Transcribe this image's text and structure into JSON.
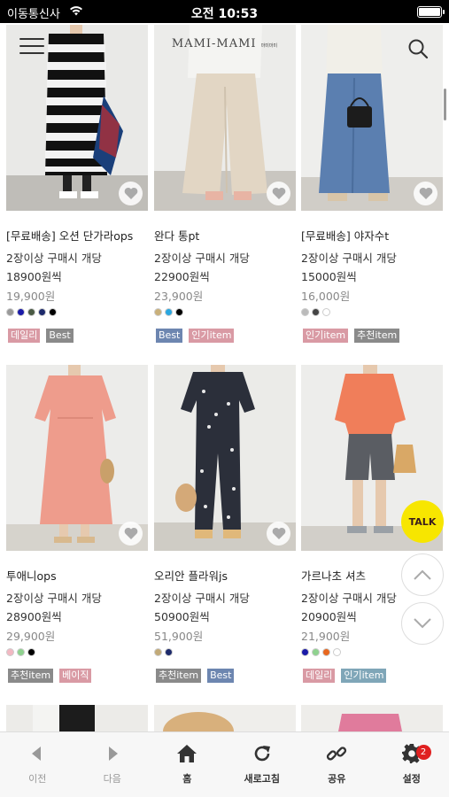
{
  "status_bar": {
    "carrier": "이동통신사",
    "time": "오전 10:53"
  },
  "header": {
    "logo": "MAMI-MAMI",
    "logo_sub": "마미마미"
  },
  "products": [
    {
      "name": "[무료배송] 오션 단가라ops",
      "promo1": "2장이상 구매시 개당",
      "promo2": "18900원씩",
      "price": "19,900원",
      "swatches": [
        "#999999",
        "#1a1aa8",
        "#4a5a44",
        "#1d2a6b",
        "#000000"
      ],
      "badges": [
        {
          "label": "데일리",
          "color": "#d99aa4"
        },
        {
          "label": "Best",
          "color": "#8a8a8a"
        }
      ]
    },
    {
      "name": "완다 통pt",
      "promo1": "2장이상 구매시 개당",
      "promo2": "22900원씩",
      "price": "23,900원",
      "swatches": [
        "#c9b07a",
        "#2aa7e0",
        "#000000"
      ],
      "badges": [
        {
          "label": "Best",
          "color": "#6d86b0"
        },
        {
          "label": "인기item",
          "color": "#d99aa4"
        }
      ]
    },
    {
      "name": "[무료배송] 야자수t",
      "promo1": "2장이상 구매시 개당",
      "promo2": "15000원씩",
      "price": "16,000원",
      "swatches": [
        "#bbbbbb",
        "#444444",
        "#ffffff"
      ],
      "badges": [
        {
          "label": "인기item",
          "color": "#d99aa4"
        },
        {
          "label": "추천item",
          "color": "#8a8a8a"
        }
      ]
    },
    {
      "name": "투애니ops",
      "promo1": "2장이상 구매시 개당",
      "promo2": "28900원씩",
      "price": "29,900원",
      "swatches": [
        "#f2b8c2",
        "#8fd28f",
        "#000000"
      ],
      "badges": [
        {
          "label": "추천item",
          "color": "#8a8a8a"
        },
        {
          "label": "베이직",
          "color": "#d99aa4"
        }
      ]
    },
    {
      "name": "오리안 플라워js",
      "promo1": "2장이상 구매시 개당",
      "promo2": "50900원씩",
      "price": "51,900원",
      "swatches": [
        "#c2aa78",
        "#1d2a6b"
      ],
      "badges": [
        {
          "label": "추천item",
          "color": "#8a8a8a"
        },
        {
          "label": "Best",
          "color": "#6d86b0"
        }
      ]
    },
    {
      "name": "가르나초 셔츠",
      "promo1": "2장이상 구매시 개당",
      "promo2": "20900원씩",
      "price": "21,900원",
      "swatches": [
        "#1a1aa8",
        "#8fd28f",
        "#e8671f",
        "#ffffff"
      ],
      "badges": [
        {
          "label": "데일리",
          "color": "#d99aa4"
        },
        {
          "label": "인기item",
          "color": "#7fa6b8"
        }
      ]
    }
  ],
  "floating": {
    "talk": "TALK"
  },
  "bottom_nav": [
    {
      "label": "이전"
    },
    {
      "label": "다음"
    },
    {
      "label": "홈"
    },
    {
      "label": "새로고침"
    },
    {
      "label": "공유"
    },
    {
      "label": "설정"
    }
  ],
  "settings_badge": "2"
}
